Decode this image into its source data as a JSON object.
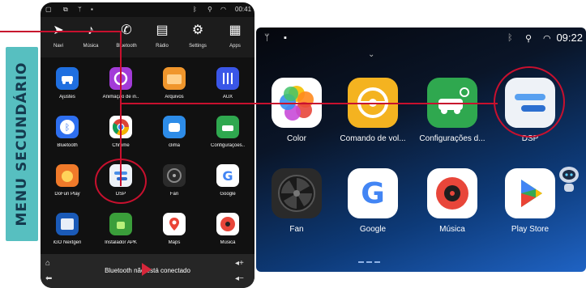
{
  "side_label": "MENU SECUNDÁRIO",
  "left": {
    "status_time": "00:41",
    "dock": [
      {
        "label": "Navi",
        "icon": "navigation-arrow-icon"
      },
      {
        "label": "Música",
        "icon": "music-note-icon"
      },
      {
        "label": "Bluetooth",
        "icon": "phone-icon"
      },
      {
        "label": "Rádio",
        "icon": "radio-icon"
      },
      {
        "label": "Settings",
        "icon": "gear-icon"
      },
      {
        "label": "Apps",
        "icon": "apps-grid-icon"
      }
    ],
    "apps": [
      {
        "label": "Ajustes"
      },
      {
        "label": "Animação de in.."
      },
      {
        "label": "Arquivos"
      },
      {
        "label": "AUX"
      },
      {
        "label": "Bluetooth"
      },
      {
        "label": "Chrome"
      },
      {
        "label": "clima"
      },
      {
        "label": "Configurações.."
      },
      {
        "label": "DoFun Play"
      },
      {
        "label": "DSP"
      },
      {
        "label": "Fan"
      },
      {
        "label": "Google"
      },
      {
        "label": "iGO Nextgen"
      },
      {
        "label": "Instalador APK"
      },
      {
        "label": "Maps"
      },
      {
        "label": "Música"
      }
    ],
    "toast": "Bluetooth não está conectado"
  },
  "right": {
    "status_time": "09:22",
    "apps": [
      {
        "label": "Color"
      },
      {
        "label": "Comando de vol..."
      },
      {
        "label": "Configurações d..."
      },
      {
        "label": "DSP"
      },
      {
        "label": "Fan"
      },
      {
        "label": "Google"
      },
      {
        "label": "Música"
      },
      {
        "label": "Play Store"
      }
    ]
  },
  "colors": {
    "accent_red": "#c8102e",
    "side_label_bg": "#57bfc0",
    "side_label_text": "#143a4e"
  }
}
